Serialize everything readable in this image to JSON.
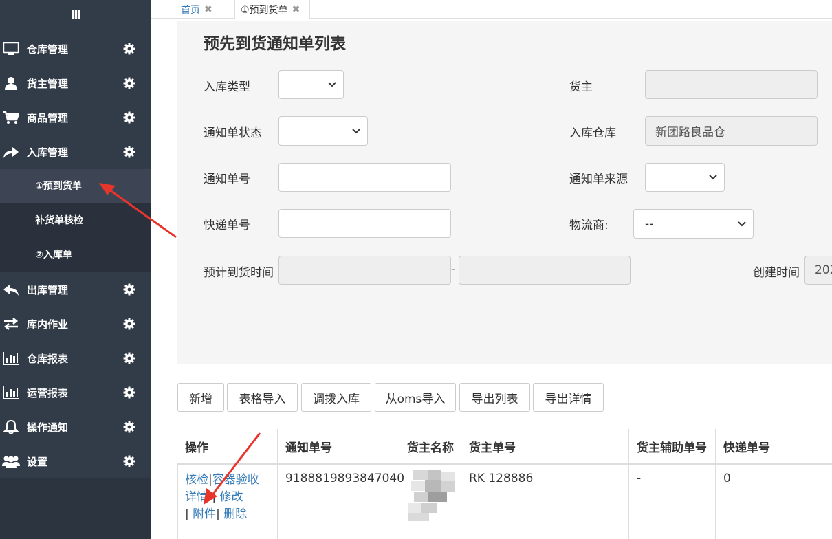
{
  "sidebar": {
    "toggle": "III",
    "items": [
      {
        "label": "仓库管理",
        "icon": "monitor-icon"
      },
      {
        "label": "货主管理",
        "icon": "user-icon"
      },
      {
        "label": "商品管理",
        "icon": "cart-icon"
      },
      {
        "label": "入库管理",
        "icon": "share-arrow-icon"
      },
      {
        "label": "出库管理",
        "icon": "reply-icon"
      },
      {
        "label": "库内作业",
        "icon": "transfer-icon"
      },
      {
        "label": "仓库报表",
        "icon": "bar-chart-icon"
      },
      {
        "label": "运营报表",
        "icon": "bar-chart-icon"
      },
      {
        "label": "操作通知",
        "icon": "bell-icon"
      },
      {
        "label": "设置",
        "icon": "users-icon"
      }
    ],
    "subitems": [
      {
        "label": "①预到货单",
        "active": true
      },
      {
        "label": "补货单核检",
        "active": false
      },
      {
        "label": "②入库单",
        "active": false
      }
    ]
  },
  "tabs": {
    "home": "首页",
    "arrival": "①预到货单",
    "close": "✖"
  },
  "page": {
    "title": "预先到货通知单列表"
  },
  "filters": {
    "inbound_type": {
      "label": "入库类型",
      "value": ""
    },
    "owner": {
      "label": "货主",
      "value": ""
    },
    "notice_status": {
      "label": "通知单状态",
      "value": ""
    },
    "warehouse": {
      "label": "入库仓库",
      "value": "新团路良品仓"
    },
    "notice_no": {
      "label": "通知单号",
      "value": ""
    },
    "notice_source": {
      "label": "通知单来源",
      "value": ""
    },
    "express_no": {
      "label": "快递单号",
      "value": ""
    },
    "logistics": {
      "label": "物流商:",
      "value": "--"
    },
    "eta": {
      "label": "预计到货时间",
      "from": "",
      "to": "",
      "dash": "-"
    },
    "created": {
      "label": "创建时间",
      "value": "202"
    }
  },
  "buttons": {
    "add": "新增",
    "import_table": "表格导入",
    "transfer_in": "调拨入库",
    "import_oms": "从oms导入",
    "export_list": "导出列表",
    "export_detail": "导出详情"
  },
  "table": {
    "headers": [
      "操作",
      "通知单号",
      "货主名称",
      "货主单号",
      "货主辅助单号",
      "快递单号"
    ],
    "row": {
      "ops": {
        "check": "核检",
        "container": "容器验收",
        "detail": "详情",
        "edit": "修改",
        "attach": "附件",
        "delete": "删除",
        "sep": "|"
      },
      "notice_no": "9188819893847040",
      "owner_name": "",
      "owner_no": "RK 128886",
      "owner_aux_no": "-",
      "express_no": "0"
    }
  },
  "colors": {
    "sidebar_bg": "#323b48",
    "link": "#337ab7",
    "annotation_arrow": "#e8352c"
  }
}
